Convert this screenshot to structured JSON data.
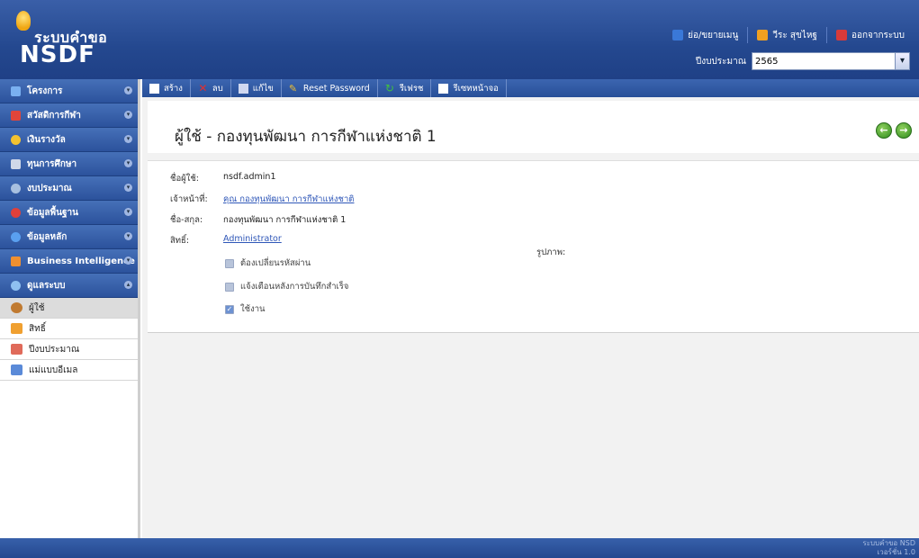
{
  "app": {
    "logo_line1": "ระบบคำขอ",
    "logo_line2": "NSDF",
    "top_links": [
      {
        "label": "ย่อ/ขยายเมนู",
        "icon": "collapse-menu-icon",
        "color": "#3a78d8"
      },
      {
        "label": "วีระ สุขไหฐ",
        "icon": "user-icon",
        "color": "#f0a020"
      },
      {
        "label": "ออกจากระบบ",
        "icon": "logout-icon",
        "color": "#d83a3a"
      }
    ],
    "year_label": "ปีงบประมาณ",
    "year_value": "2565"
  },
  "sidebar": {
    "groups": [
      {
        "label": "โครงการ",
        "icon": "project-icon",
        "color": "#7ab0f0"
      },
      {
        "label": "สวัสดิการกีฬา",
        "icon": "welfare-icon",
        "color": "#e0453a"
      },
      {
        "label": "เงินรางวัล",
        "icon": "reward-icon",
        "color": "#f3c230"
      },
      {
        "label": "ทุนการศึกษา",
        "icon": "scholarship-icon",
        "color": "#d0d8e8"
      },
      {
        "label": "งบประมาณ",
        "icon": "budget-icon",
        "color": "#a8c0e0"
      },
      {
        "label": "ข้อมูลพื้นฐาน",
        "icon": "basic-data-icon",
        "color": "#e0403a"
      },
      {
        "label": "ข้อมูลหลัก",
        "icon": "master-data-icon",
        "color": "#5aa0f0"
      },
      {
        "label": "Business Intelligence",
        "icon": "bi-icon",
        "color": "#f09030"
      },
      {
        "label": "ดูแลระบบ",
        "icon": "admin-icon",
        "color": "#8fc0f0"
      }
    ],
    "items": [
      {
        "label": "ผู้ใช้",
        "icon": "users-icon",
        "color": "#c07a30"
      },
      {
        "label": "สิทธิ์",
        "icon": "permission-icon",
        "color": "#f0a030"
      },
      {
        "label": "ปีงบประมาณ",
        "icon": "fiscal-year-icon",
        "color": "#e06a5a"
      },
      {
        "label": "แม่แบบอีเมล",
        "icon": "email-template-icon",
        "color": "#5a8ad8"
      }
    ]
  },
  "toolbar": {
    "buttons": [
      {
        "label": "สร้าง",
        "icon": "create-icon",
        "color": "#ffffff"
      },
      {
        "label": "ลบ",
        "icon": "delete-icon",
        "color": "#e03030"
      },
      {
        "label": "แก้ไข",
        "icon": "edit-icon",
        "color": "#d0d8f0"
      },
      {
        "label": "Reset Password",
        "icon": "key-icon",
        "color": "#f0c030"
      },
      {
        "label": "รีเฟรช",
        "icon": "refresh-icon",
        "color": "#40c040"
      },
      {
        "label": "รีเซทหน้าจอ",
        "icon": "reset-screen-icon",
        "color": "#ffffff"
      }
    ]
  },
  "main": {
    "title": "ผู้ใช้ - กองทุนพัฒนา การกีฬาแห่งชาติ 1",
    "fields": {
      "username_label": "ชื่อผู้ใช้:",
      "username_value": "nsdf.admin1",
      "officer_label": "เจ้าหน้าที่:",
      "officer_value": "คุณ กองทุนพัฒนา การกีฬาแห่งชาติ",
      "fullname_label": "ชื่อ-สกุล:",
      "fullname_value": "กองทุนพัฒนา การกีฬาแห่งชาติ 1",
      "role_label": "สิทธิ์:",
      "role_value": "Administrator",
      "picture_label": "รูปภาพ:"
    },
    "checkboxes": [
      {
        "label": "ต้องเปลี่ยนรหัสผ่าน",
        "checked": false
      },
      {
        "label": "แจ้งเตือนหลังการบันทึกสำเร็จ",
        "checked": false
      },
      {
        "label": "ใช้งาน",
        "checked": true
      }
    ]
  },
  "footer": {
    "line1": "ระบบคำขอ NSD",
    "line2": "เวอร์ชั่น 1.0"
  }
}
